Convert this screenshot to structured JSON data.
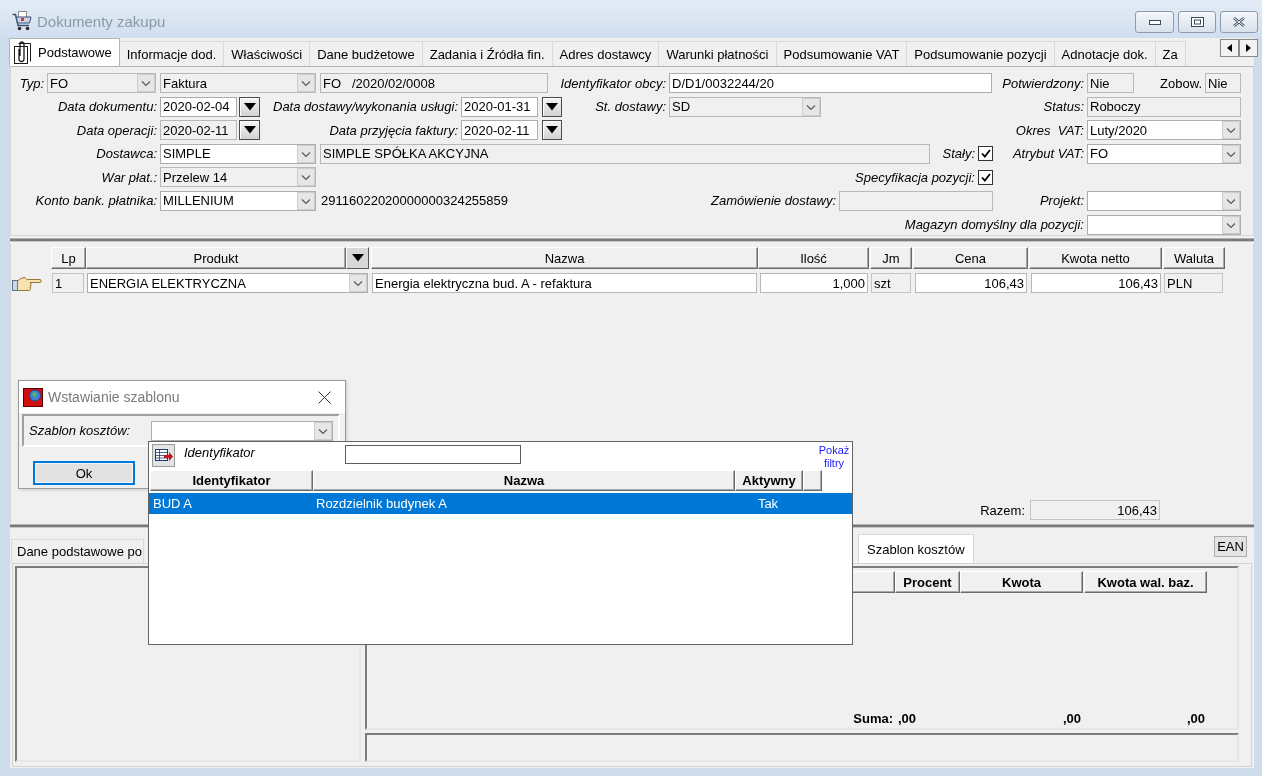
{
  "window": {
    "title": "Dokumenty zakupu"
  },
  "tabs": [
    {
      "label": "Podstawowe",
      "selected": true
    },
    {
      "label": "Informacje dod.",
      "selected": false
    },
    {
      "label": "Właściwości",
      "selected": false
    },
    {
      "label": "Dane budżetowe",
      "selected": false
    },
    {
      "label": "Zadania i Źródła fin.",
      "selected": false
    },
    {
      "label": "Adres dostawcy",
      "selected": false
    },
    {
      "label": "Warunki płatności",
      "selected": false
    },
    {
      "label": "Podsumowanie VAT",
      "selected": false
    },
    {
      "label": "Podsumowanie pozycji",
      "selected": false
    },
    {
      "label": "Adnotacje dok.",
      "selected": false
    },
    {
      "label": "Za",
      "selected": false
    }
  ],
  "header_form": {
    "document_type": {
      "label": "Typ:",
      "code": {
        "value": "FO",
        "disabled": true
      },
      "name": {
        "value": "Faktura",
        "disabled": true
      },
      "number": {
        "value": "FO   /2020/02/0008",
        "disabled": true
      }
    },
    "external_id": {
      "label": "Identyfikator obcy:",
      "value": "D/D1/0032244/20",
      "disabled": false
    },
    "confirmed": {
      "label": "Potwierdzony:",
      "value": "Nie",
      "disabled": true
    },
    "obligation": {
      "label": "Zobow.",
      "value": "Nie",
      "disabled": true
    },
    "document_date": {
      "label": "Data dokumentu:",
      "value": "2020-02-04",
      "disabled": false
    },
    "delivery_date": {
      "label": "Data dostawy/wykonania usługi:",
      "value": "2020-01-31",
      "disabled": false
    },
    "delivery_status": {
      "label": "St. dostawy:",
      "value": "SD",
      "disabled": true
    },
    "status": {
      "label": "Status:",
      "value": "Roboczy",
      "disabled": true
    },
    "operation_date": {
      "label": "Data operacji:",
      "value": "2020-02-11",
      "disabled": true
    },
    "invoice_receipt_date": {
      "label": "Data przyjęcia faktury:",
      "value": "2020-02-11",
      "disabled": false
    },
    "vat_period": {
      "label": "Okres  VAT:",
      "value": "Luty/2020",
      "disabled": false
    },
    "supplier": {
      "label": "Dostawca:",
      "code": {
        "value": "SIMPLE",
        "disabled": false
      },
      "name": {
        "value": "SIMPLE SPÓŁKA AKCYJNA",
        "disabled": true
      }
    },
    "permanent": {
      "label": "Stały:",
      "checked": true
    },
    "vat_attribute": {
      "label": "Atrybut VAT:",
      "value": "FO",
      "disabled": false
    },
    "payment_terms": {
      "label": "War płat.:",
      "value": "Przelew 14",
      "disabled": true
    },
    "item_specification": {
      "label": "Specyfikacja pozycji:",
      "checked": true
    },
    "payer_bank_account": {
      "label": "Konto bank. płatnika:",
      "bank": {
        "value": "MILLENIUM",
        "disabled": false
      },
      "number": "29116022020000000324255859"
    },
    "delivery_order": {
      "label": "Zamówienie dostawy:",
      "disabled": true
    },
    "project": {
      "label": "Projekt:",
      "disabled": false
    },
    "default_warehouse": {
      "label": "Magazyn domyślny dla pozycji:",
      "disabled": false
    }
  },
  "items_table": {
    "columns": [
      "Lp",
      "Produkt",
      "Nazwa",
      "Ilość",
      "Jm",
      "Cena",
      "Kwota netto",
      "Waluta"
    ],
    "rows": [
      {
        "selected": true,
        "lp": "1",
        "product": "ENERGIA ELEKTRYCZNA",
        "name": "Energia elektryczna bud. A - refaktura",
        "quantity": "1,000",
        "unit": "szt",
        "price": "106,43",
        "net_amount": "106,43",
        "currency": "PLN"
      }
    ]
  },
  "total": {
    "label": "Razem:",
    "value": "106,43"
  },
  "detail_tabs": [
    {
      "label": "Dane podstawowe po",
      "selected": false
    },
    {
      "label": "Szablon kosztów",
      "selected": true
    }
  ],
  "ean_button": "EAN",
  "cost_table": {
    "columns": [
      "Procent",
      "Kwota",
      "Kwota wal. baz."
    ],
    "sum_label": "Suma:",
    "sums": [
      ",00",
      ",00",
      ",00"
    ]
  },
  "template_dialog": {
    "title": "Wstawianie szablonu",
    "field_label": "Szablon kosztów:",
    "ok_button": "Ok"
  },
  "template_lookup": {
    "filter_label": "Identyfikator",
    "show_filters_link": "Pokaż filtry",
    "columns": [
      "Identyfikator",
      "Nazwa",
      "Aktywny"
    ],
    "rows": [
      {
        "id": "BUD A",
        "name": "Rozdzielnik budynek A",
        "active": "Tak",
        "selected": true
      }
    ]
  }
}
